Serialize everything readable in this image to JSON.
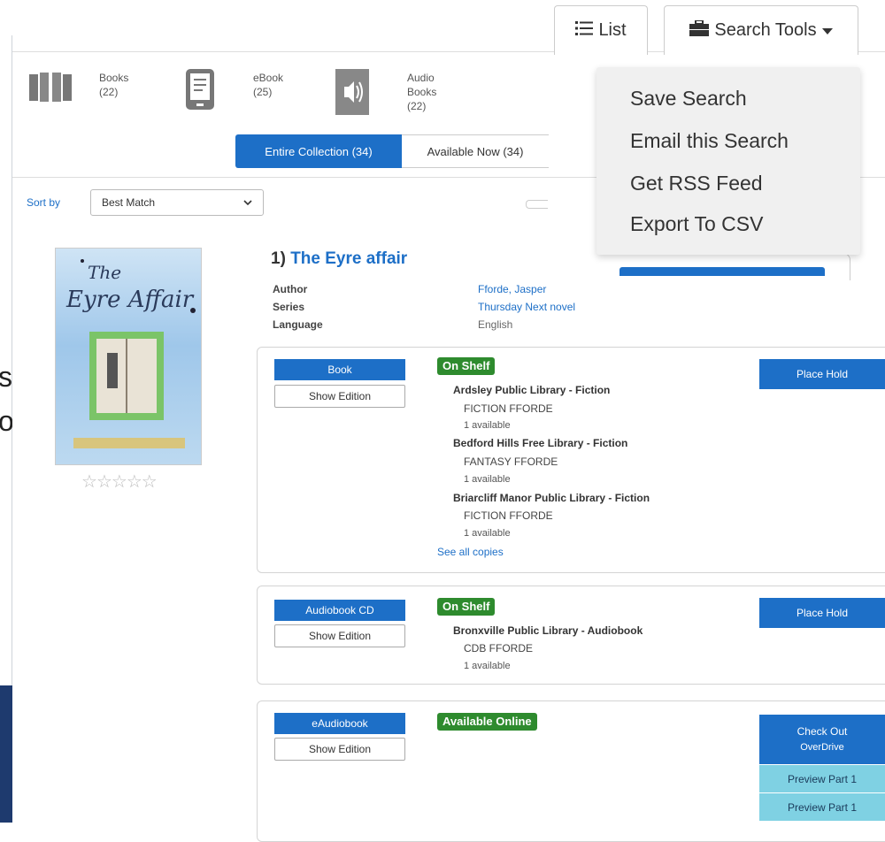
{
  "toolbar": {
    "list_label": "List",
    "search_tools_label": "Search Tools"
  },
  "formats": [
    {
      "label": "Books",
      "count": "(22)",
      "icon": "open-book-icon"
    },
    {
      "label": "eBook",
      "count": "(25)",
      "icon": "ereader-icon"
    },
    {
      "label": "Audio",
      "label2": "Books",
      "count": "(22)",
      "icon": "speaker-icon"
    }
  ],
  "tabs": [
    {
      "label": "Entire Collection (34)",
      "active": true
    },
    {
      "label": "Available Now (34)",
      "active": false
    }
  ],
  "sort": {
    "label": "Sort by",
    "selected": "Best Match"
  },
  "dropdown": {
    "items": [
      "Save Search",
      "Email this Search",
      "Get RSS Feed",
      "Export To CSV"
    ]
  },
  "background_text": {
    "line1": "s",
    "line2": "o"
  },
  "record": {
    "number": "1)",
    "title": "The Eyre affair",
    "meta": [
      {
        "label": "Author",
        "value": "Fforde, Jasper",
        "link": true
      },
      {
        "label": "Series",
        "value": "Thursday Next novel",
        "link": true
      },
      {
        "label": "Language",
        "value": "English",
        "link": false
      }
    ],
    "rating_stars": 5,
    "rating_value": 0
  },
  "holdings": [
    {
      "format": "Book",
      "edition": "Show Edition",
      "status": "On Shelf",
      "action": "Place Hold",
      "locations": [
        {
          "name": "Ardsley Public Library - Fiction",
          "call": "FICTION FFORDE",
          "avail": "1 available"
        },
        {
          "name": "Bedford Hills Free Library - Fiction",
          "call": "FANTASY FFORDE",
          "avail": "1 available"
        },
        {
          "name": "Briarcliff Manor Public Library - Fiction",
          "call": "FICTION FFORDE",
          "avail": "1 available"
        }
      ],
      "see_all": "See all copies"
    },
    {
      "format": "Audiobook CD",
      "edition": "Show Edition",
      "status": "On Shelf",
      "action": "Place Hold",
      "locations": [
        {
          "name": "Bronxville Public Library - Audiobook",
          "call": "CDB FFORDE",
          "avail": "1 available"
        }
      ]
    },
    {
      "format": "eAudiobook",
      "edition": "Show Edition",
      "status": "Available Online",
      "action": "Check Out",
      "action2": "OverDrive",
      "previews": [
        "Preview Part 1",
        "Preview Part 1"
      ]
    }
  ],
  "colors": {
    "accent": "#1d6fc7",
    "status_green": "#2e8b2e",
    "preview_cyan": "#7fd1e3",
    "dark_panel": "#1e3a6e"
  }
}
